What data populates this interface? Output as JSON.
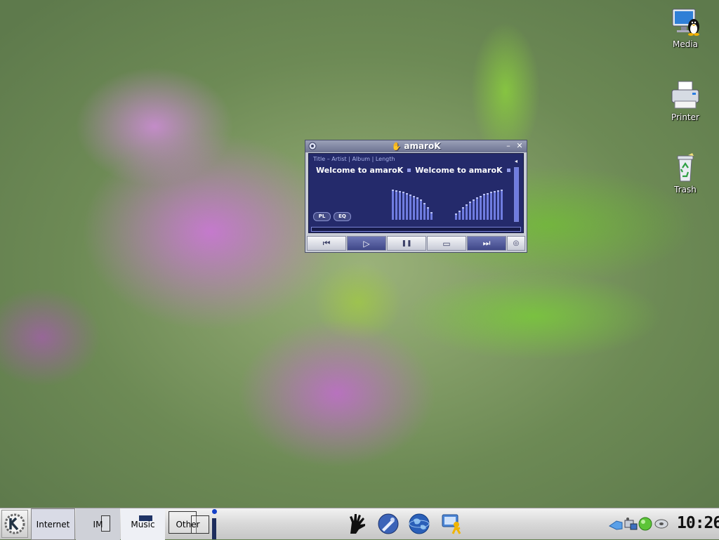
{
  "desktop": {
    "icons": [
      {
        "label": "Media",
        "icon": "computer-monitor-tux-icon"
      },
      {
        "label": "Printer",
        "icon": "printer-icon"
      },
      {
        "label": "Trash",
        "icon": "recycle-bin-icon"
      }
    ]
  },
  "player": {
    "app_name": "amaroK",
    "column_header": "Title – Artist | Album | Length",
    "scroll_text_1": "Welcome to amaroK",
    "scroll_text_2": "Welcome to amaroK",
    "pl_label": "PL",
    "eq_label": "EQ",
    "volume_fraction": 1.0,
    "seek_fraction": 0.0,
    "analyzer_levels": [
      0.97,
      0.95,
      0.93,
      0.9,
      0.87,
      0.82,
      0.78,
      0.72,
      0.65,
      0.55,
      0.4,
      0.25,
      0.0,
      0.0,
      0.0,
      0.0,
      0.0,
      0.0,
      0.2,
      0.3,
      0.4,
      0.5,
      0.58,
      0.65,
      0.72,
      0.78,
      0.83,
      0.87,
      0.9,
      0.93,
      0.95,
      0.97
    ],
    "controls": [
      {
        "name": "previous",
        "icon": "prev-track-icon",
        "glyph": "⏮"
      },
      {
        "name": "play",
        "icon": "play-icon",
        "glyph": "▷"
      },
      {
        "name": "pause",
        "icon": "pause-icon",
        "glyph": "❚❚"
      },
      {
        "name": "stop",
        "icon": "stop-icon",
        "glyph": "▭"
      },
      {
        "name": "next",
        "icon": "next-track-icon",
        "glyph": "⏭"
      },
      {
        "name": "options",
        "icon": "options-icon",
        "glyph": "◎"
      }
    ],
    "colors": {
      "display_bg": "#242a6b",
      "bar": "#6f7ce0",
      "bar_light": "#b8c0f5"
    }
  },
  "taskbar": {
    "desktops": [
      {
        "label": "Internet"
      },
      {
        "label": "IM"
      },
      {
        "label": "Music"
      },
      {
        "label": "Other"
      }
    ],
    "launchers": [
      "amarok-hand-icon",
      "konqueror-icon",
      "web-browser-globe-icon",
      "kopete-messenger-icon"
    ],
    "tray": [
      "volume-speaker-icon",
      "network-icon",
      "green-status-icon",
      "cd-drive-icon"
    ],
    "clock": "10:26"
  }
}
